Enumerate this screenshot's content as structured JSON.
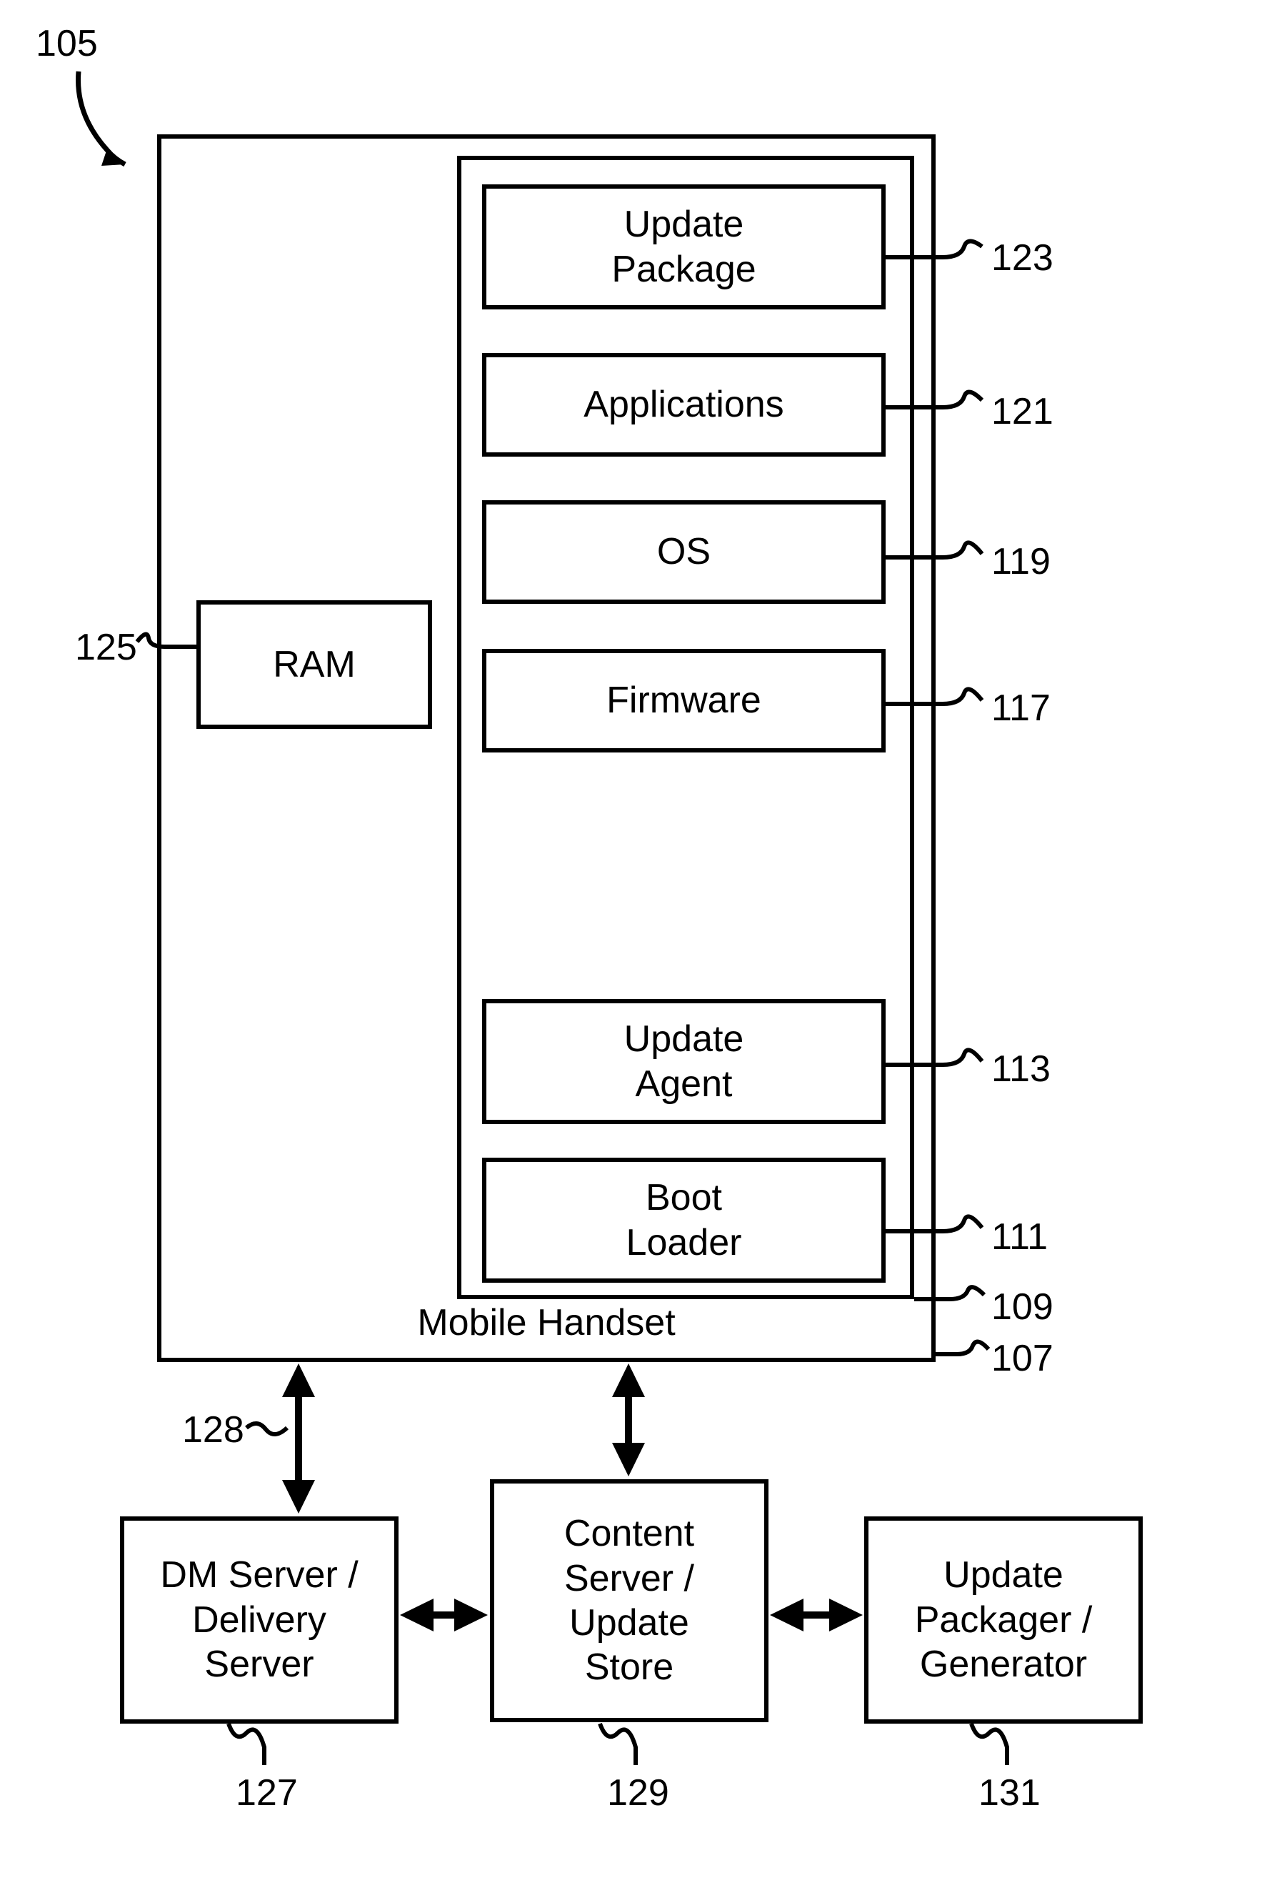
{
  "diagram_id": "105",
  "handset": {
    "title": "Mobile Handset",
    "ref_outer": "107",
    "ref_inner": "109",
    "ram": {
      "label": "RAM",
      "ref": "125"
    },
    "stack": {
      "update_package": {
        "label_line1": "Update",
        "label_line2": "Package",
        "ref": "123"
      },
      "applications": {
        "label": "Applications",
        "ref": "121"
      },
      "os": {
        "label": "OS",
        "ref": "119"
      },
      "firmware": {
        "label": "Firmware",
        "ref": "117"
      },
      "update_agent": {
        "label_line1": "Update",
        "label_line2": "Agent",
        "ref": "113"
      },
      "boot_loader": {
        "label_line1": "Boot",
        "label_line2": "Loader",
        "ref": "111"
      }
    }
  },
  "servers": {
    "dm": {
      "line1": "DM Server /",
      "line2": "Delivery",
      "line3": "Server",
      "ref": "127"
    },
    "content": {
      "line1": "Content",
      "line2": "Server /",
      "line3": "Update",
      "line4": "Store",
      "ref": "129"
    },
    "packager": {
      "line1": "Update",
      "line2": "Packager /",
      "line3": "Generator",
      "ref": "131"
    }
  },
  "link_ref": "128"
}
